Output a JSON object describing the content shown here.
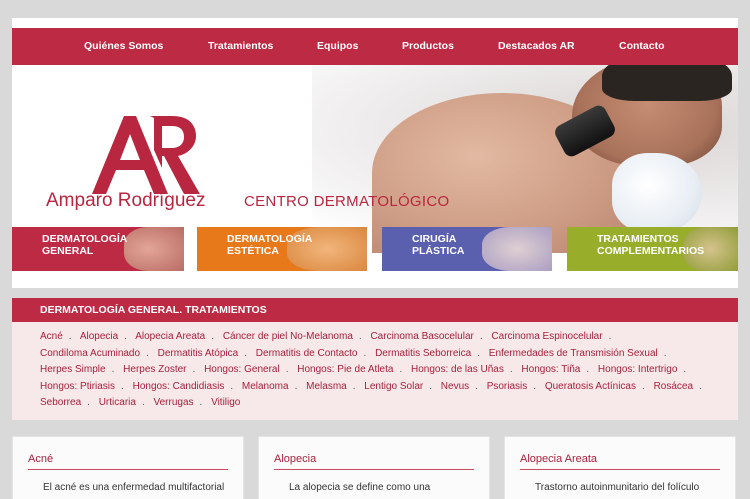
{
  "nav": {
    "items": [
      "Quiénes Somos",
      "Tratamientos",
      "Equipos",
      "Productos",
      "Destacados AR",
      "Contacto"
    ]
  },
  "brand": {
    "name": "Amparo Rodríguez",
    "subtitle": "CENTRO DERMATOLÓGICO"
  },
  "tiles": [
    {
      "line1": "DERMATOLOGÍA",
      "line2": "GENERAL",
      "color": "#bd2a43"
    },
    {
      "line1": "DERMATOLOGÍA",
      "line2": "ESTÉTICA",
      "color": "#e8791a"
    },
    {
      "line1": "CIRUGÍA",
      "line2": "PLÁSTICA",
      "color": "#5a5fae"
    },
    {
      "line1": "TRATAMIENTOS",
      "line2": "COMPLEMENTARIOS",
      "color": "#98ad2a"
    }
  ],
  "section": {
    "title": "DERMATOLOGÍA GENERAL. TRATAMIENTOS",
    "terms": [
      "Acné",
      "Alopecia",
      "Alopecia Areata",
      "Cáncer de piel No-Melanoma",
      "Carcinoma Basocelular",
      "Carcinoma Espinocelular",
      "Condiloma Acuminado",
      "Dermatitis Atópica",
      "Dermatitis de Contacto",
      "Dermatitis Seborreica",
      "Enfermedades de Transmisión Sexual",
      "Herpes Simple",
      "Herpes Zoster",
      "Hongos: General",
      "Hongos: Pie de Atleta",
      "Hongos: de las Uñas",
      "Hongos: Tiña",
      "Hongos: Intertrigo",
      "Hongos: Ptiriasis",
      "Hongos: Candidiasis",
      "Melanoma",
      "Melasma",
      "Lentigo Solar",
      "Nevus",
      "Psoriasis",
      "Queratosis Actínicas",
      "Rosácea",
      "Seborrea",
      "Urticaria",
      "Verrugas",
      "Vitiligo"
    ]
  },
  "cards": [
    {
      "title": "Acné",
      "text": "El acné es una enfermedad multifactorial"
    },
    {
      "title": "Alopecia",
      "text": "La alopecia se define como una"
    },
    {
      "title": "Alopecia Areata",
      "text": "Trastorno autoinmunitario del folículo"
    }
  ],
  "colors": {
    "accent": "#bd2a43",
    "background": "#d9d9d9",
    "section_bg": "#f7e8ea"
  }
}
